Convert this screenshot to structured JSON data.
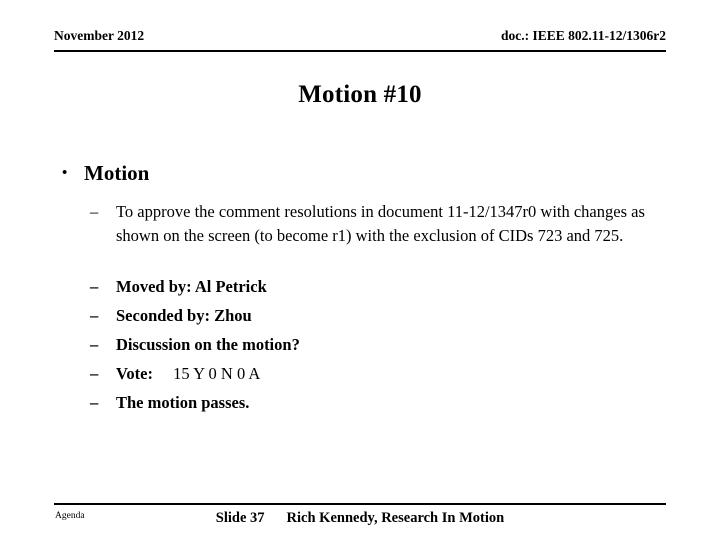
{
  "header": {
    "date": "November 2012",
    "doc": "doc.: IEEE 802.11-12/1306r2"
  },
  "title": "Motion #10",
  "content": {
    "level1": {
      "bullet_glyph": "•",
      "text": "Motion"
    },
    "dash_glyph": "–",
    "proposal": "To approve the comment resolutions in document 11-12/1347r0 with changes as shown on the screen (to become r1) with the exclusion of CIDs 723 and 725.",
    "details": [
      {
        "label": "Moved by: Al Petrick",
        "value": ""
      },
      {
        "label": "Seconded by: Zhou",
        "value": ""
      },
      {
        "label": "Discussion on the motion?",
        "value": ""
      },
      {
        "label": "Vote:",
        "value": "15 Y  0 N  0 A"
      },
      {
        "label": "The motion passes.",
        "value": ""
      }
    ]
  },
  "footer": {
    "agenda": "Agenda",
    "slide": "Slide 37",
    "author": "Rich Kennedy, Research In Motion"
  }
}
